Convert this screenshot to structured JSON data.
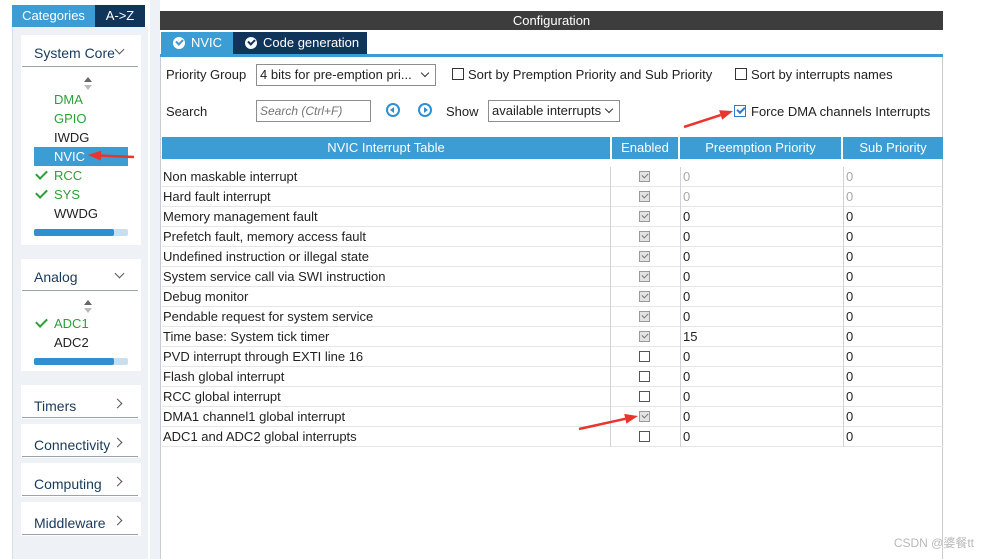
{
  "sidebar": {
    "tabs": [
      {
        "label": "Categories",
        "active": true
      },
      {
        "label": "A->Z",
        "active": false
      }
    ],
    "categories": {
      "system_core": {
        "label": "System Core",
        "items": [
          {
            "label": "DMA",
            "checked": false,
            "style": "green"
          },
          {
            "label": "GPIO",
            "checked": false,
            "style": "green"
          },
          {
            "label": "IWDG",
            "checked": false,
            "style": "plain"
          },
          {
            "label": "NVIC",
            "checked": false,
            "style": "selected"
          },
          {
            "label": "RCC",
            "checked": true,
            "style": "green"
          },
          {
            "label": "SYS",
            "checked": true,
            "style": "green"
          },
          {
            "label": "WWDG",
            "checked": false,
            "style": "plain"
          }
        ]
      },
      "analog": {
        "label": "Analog",
        "items": [
          {
            "label": "ADC1",
            "checked": true,
            "style": "green"
          },
          {
            "label": "ADC2",
            "checked": false,
            "style": "plain"
          }
        ]
      },
      "timers": {
        "label": "Timers"
      },
      "connectivity": {
        "label": "Connectivity"
      },
      "computing": {
        "label": "Computing"
      },
      "middleware": {
        "label": "Middleware"
      }
    }
  },
  "main": {
    "title": "Configuration",
    "tabs": [
      {
        "label": "NVIC",
        "active": true
      },
      {
        "label": "Code generation",
        "active": false
      }
    ],
    "controls": {
      "priority_group_label": "Priority Group",
      "priority_group_value": "4 bits for pre-emption pri...",
      "sort_premption_label": "Sort by Premption Priority and Sub Priority",
      "sort_premption_checked": false,
      "sort_names_label": "Sort by interrupts names",
      "sort_names_checked": false,
      "search_label": "Search",
      "search_placeholder": "Search (Ctrl+F)",
      "show_label": "Show",
      "show_value": "available interrupts",
      "force_dma_label": "Force DMA channels Interrupts",
      "force_dma_checked": true
    },
    "table": {
      "headers": [
        "NVIC Interrupt Table",
        "Enabled",
        "Preemption Priority",
        "Sub Priority"
      ],
      "rows": [
        {
          "name": "Non maskable interrupt",
          "enabled": true,
          "preemption": "0",
          "sub": "0",
          "locked": true
        },
        {
          "name": "Hard fault interrupt",
          "enabled": true,
          "preemption": "0",
          "sub": "0",
          "locked": true
        },
        {
          "name": "Memory management fault",
          "enabled": true,
          "preemption": "0",
          "sub": "0",
          "locked": false
        },
        {
          "name": "Prefetch fault, memory access fault",
          "enabled": true,
          "preemption": "0",
          "sub": "0",
          "locked": false
        },
        {
          "name": "Undefined instruction or illegal state",
          "enabled": true,
          "preemption": "0",
          "sub": "0",
          "locked": false
        },
        {
          "name": "System service call via SWI instruction",
          "enabled": true,
          "preemption": "0",
          "sub": "0",
          "locked": false
        },
        {
          "name": "Debug monitor",
          "enabled": true,
          "preemption": "0",
          "sub": "0",
          "locked": false
        },
        {
          "name": "Pendable request for system service",
          "enabled": true,
          "preemption": "0",
          "sub": "0",
          "locked": false
        },
        {
          "name": "Time base: System tick timer",
          "enabled": true,
          "preemption": "15",
          "sub": "0",
          "locked": false
        },
        {
          "name": "PVD interrupt through EXTI line 16",
          "enabled": false,
          "preemption": "0",
          "sub": "0",
          "locked": false
        },
        {
          "name": "Flash global interrupt",
          "enabled": false,
          "preemption": "0",
          "sub": "0",
          "locked": false
        },
        {
          "name": "RCC global interrupt",
          "enabled": false,
          "preemption": "0",
          "sub": "0",
          "locked": false
        },
        {
          "name": "DMA1 channel1 global interrupt",
          "enabled": true,
          "preemption": "0",
          "sub": "0",
          "locked": false
        },
        {
          "name": "ADC1 and ADC2 global interrupts",
          "enabled": false,
          "preemption": "0",
          "sub": "0",
          "locked": false
        }
      ]
    }
  },
  "annotation_color": "#e8352e",
  "watermark": "CSDN @婆餐tt"
}
